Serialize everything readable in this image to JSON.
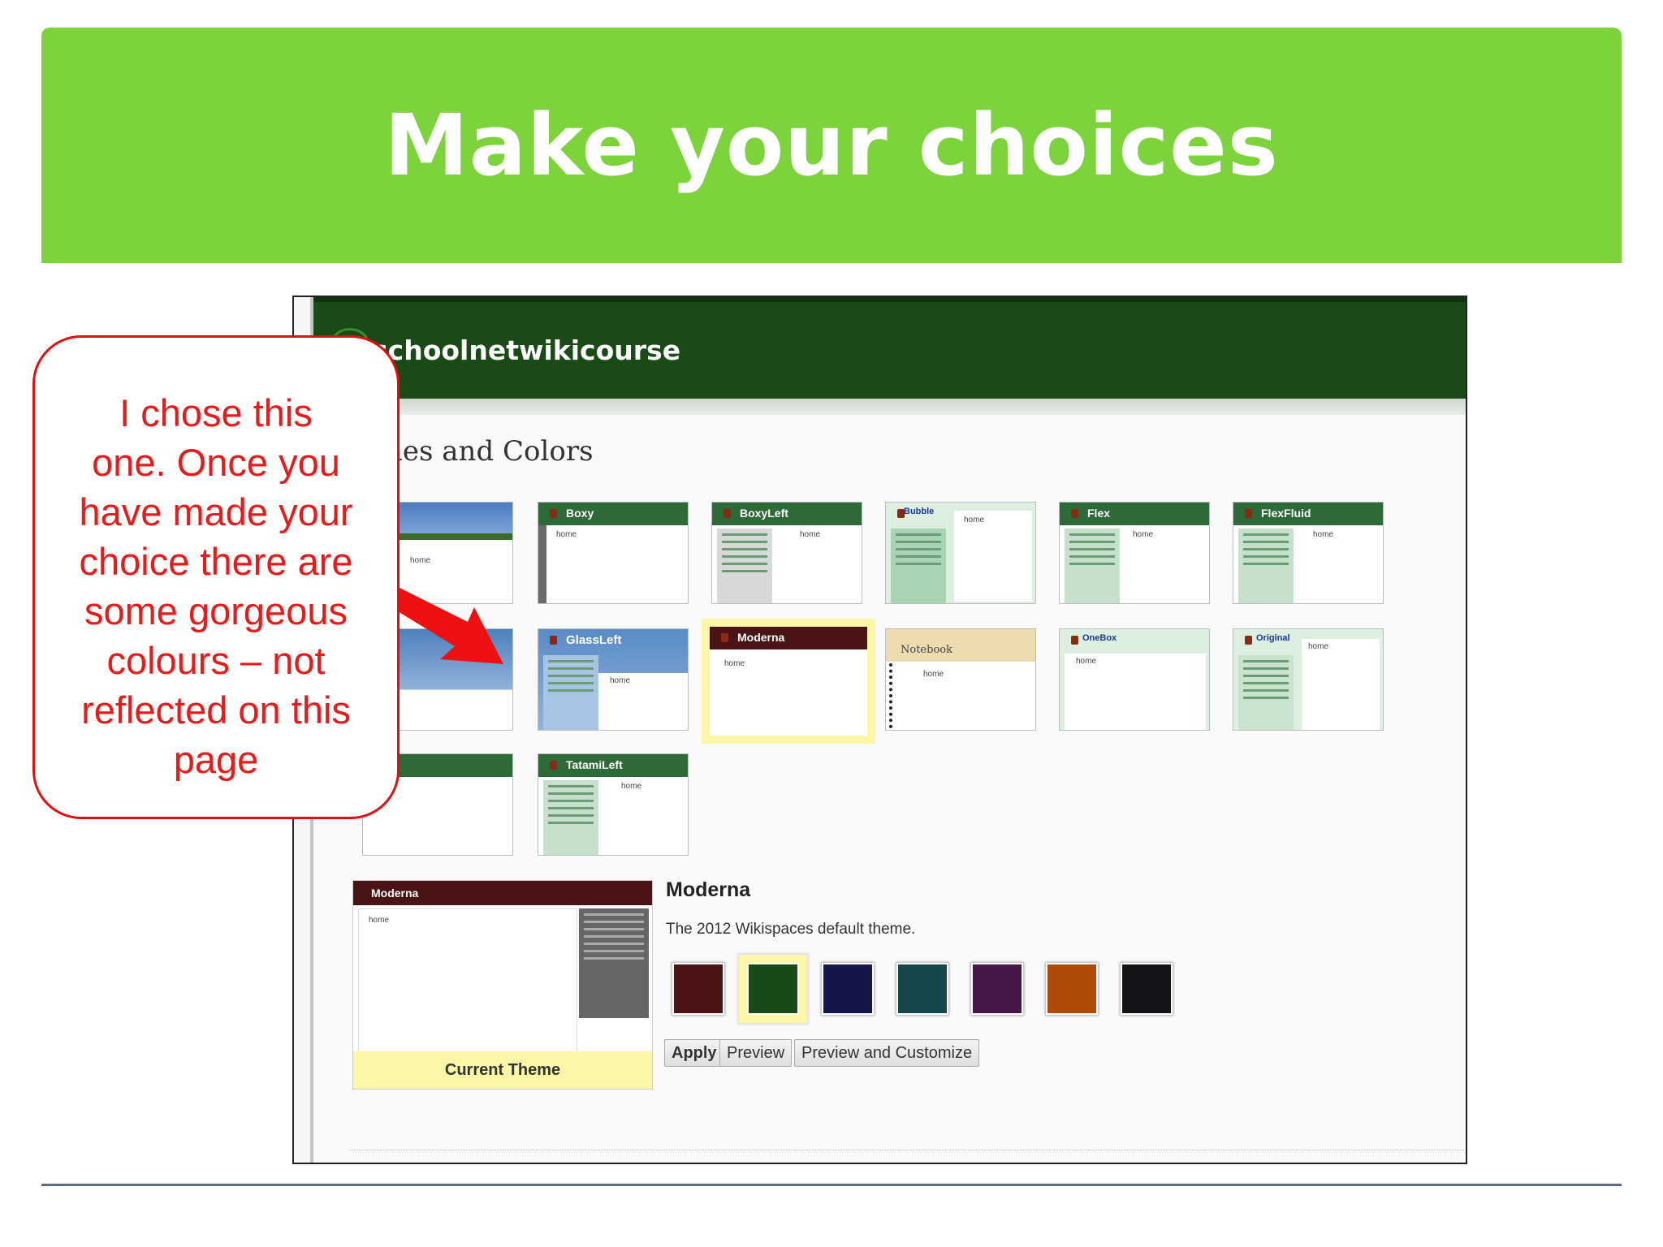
{
  "slide": {
    "title": "Make your choices"
  },
  "wiki": {
    "name": "schoolnetwikicourse",
    "section_heading": "nes and Colors"
  },
  "themes": {
    "boxy": "Boxy",
    "boxyleft": "BoxyLeft",
    "bubble": "Bubble",
    "flex": "Flex",
    "flexfluid": "FlexFluid",
    "glassleft": "GlassLeft",
    "moderna": "Moderna",
    "notebook": "Notebook",
    "onebox": "OneBox",
    "original": "Original",
    "tatamileft": "TatamiLeft",
    "home": "home"
  },
  "current": {
    "preview_title": "Moderna",
    "preview_home": "home",
    "label": "Current Theme",
    "name": "Moderna",
    "description": "The 2012 Wikispaces default theme."
  },
  "swatches": [
    "#4a1414",
    "#174a18",
    "#15154a",
    "#14484a",
    "#451848",
    "#b04a08",
    "#141418"
  ],
  "selected_swatch": "#174a18",
  "buttons": {
    "apply": "Apply",
    "preview": "Preview",
    "preview_customize": "Preview and Customize"
  },
  "callout": {
    "lines": [
      "I chose this",
      "one. Once you",
      "have made your",
      "choice there are",
      "some gorgeous",
      "colours – not",
      "reflected on this",
      "page"
    ]
  }
}
